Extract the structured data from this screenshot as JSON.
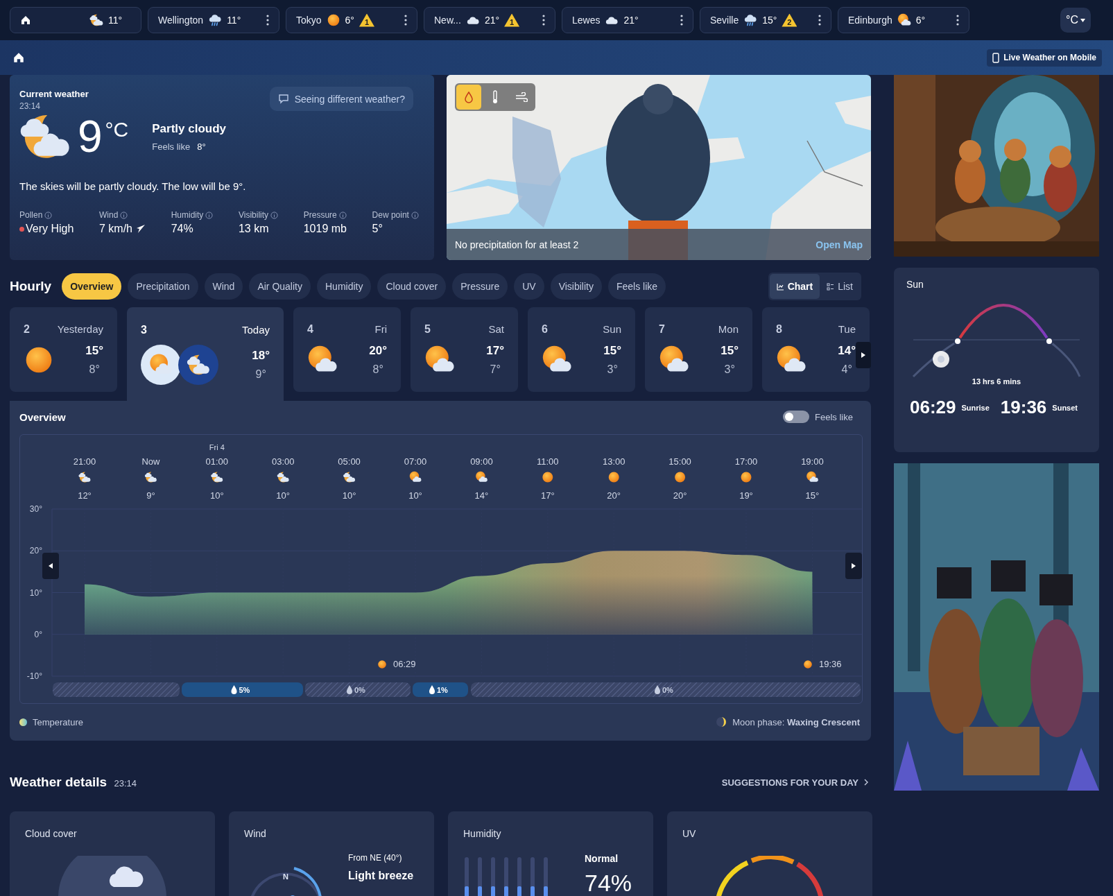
{
  "locations": [
    {
      "kind": "moon-cloud",
      "temp": "11°"
    },
    {
      "kind": "rain-cloud",
      "name": "Wellington",
      "temp": "11°"
    },
    {
      "kind": "sun",
      "name": "Tokyo",
      "temp": "6°",
      "alert": "1"
    },
    {
      "kind": "cloud",
      "name": "New...",
      "temp": "21°",
      "alert": "1"
    },
    {
      "kind": "cloud",
      "name": "Lewes",
      "temp": "21°"
    },
    {
      "kind": "rain-cloud",
      "name": "Seville",
      "temp": "15°",
      "alert": "2"
    },
    {
      "kind": "sun-cloud",
      "name": "Edinburgh",
      "temp": "6°"
    }
  ],
  "unit_button": "°C",
  "mobile_link": "Live Weather on Mobile",
  "current": {
    "title": "Current weather",
    "time": "23:14",
    "temp": "9",
    "unit": "°C",
    "condition": "Partly cloudy",
    "feels_like_label": "Feels like",
    "feels_like": "8°",
    "feedback_button": "Seeing different weather?",
    "summary": "The skies will be partly cloudy. The low will be 9°.",
    "stats": [
      {
        "kind": "pollen",
        "label": "Pollen",
        "value": "Very High"
      },
      {
        "kind": "wind",
        "label": "Wind",
        "value": "7 km/h"
      },
      {
        "kind": "plain",
        "label": "Humidity",
        "value": "74%"
      },
      {
        "kind": "plain",
        "label": "Visibility",
        "value": "13 km"
      },
      {
        "kind": "plain",
        "label": "Pressure",
        "value": "1019 mb"
      },
      {
        "kind": "plain",
        "label": "Dew point",
        "value": "5°"
      }
    ]
  },
  "map": {
    "layers": [
      {
        "kind": "precipitation",
        "selected": true
      },
      {
        "kind": "temperature",
        "selected": false
      },
      {
        "kind": "wind",
        "selected": false
      }
    ],
    "message": "No precipitation for at least 2",
    "link": "Open Map"
  },
  "hourly": {
    "title": "Hourly",
    "tabs": [
      {
        "label": "Overview",
        "selected": true
      },
      {
        "label": "Precipitation",
        "selected": false
      },
      {
        "label": "Wind",
        "selected": false
      },
      {
        "label": "Air Quality",
        "selected": false
      },
      {
        "label": "Humidity",
        "selected": false
      },
      {
        "label": "Cloud cover",
        "selected": false
      },
      {
        "label": "Pressure",
        "selected": false
      },
      {
        "label": "UV",
        "selected": false
      },
      {
        "label": "Visibility",
        "selected": false
      },
      {
        "label": "Feels like",
        "selected": false
      }
    ],
    "views": [
      {
        "kind": "chart",
        "label": "Chart",
        "selected": true
      },
      {
        "kind": "list",
        "label": "List",
        "selected": false
      }
    ],
    "days": [
      {
        "kind": "sun",
        "number": "2",
        "name": "Yesterday",
        "high": "15°",
        "low": "8°",
        "selected": false
      },
      {
        "kind": "day-night",
        "number": "3",
        "name": "Today",
        "high": "18°",
        "low": "9°",
        "selected": true
      },
      {
        "kind": "sun-cloud",
        "number": "4",
        "name": "Fri",
        "high": "20°",
        "low": "8°",
        "selected": false
      },
      {
        "kind": "sun-cloud",
        "number": "5",
        "name": "Sat",
        "high": "17°",
        "low": "7°",
        "selected": false
      },
      {
        "kind": "sun-cloud",
        "number": "6",
        "name": "Sun",
        "high": "15°",
        "low": "3°",
        "selected": false
      },
      {
        "kind": "sun-cloud",
        "number": "7",
        "name": "Mon",
        "high": "15°",
        "low": "3°",
        "selected": false
      },
      {
        "kind": "sun-cloud",
        "number": "8",
        "name": "Tue",
        "high": "14°",
        "low": "4°",
        "selected": false
      }
    ]
  },
  "overview": {
    "title": "Overview",
    "toggle": {
      "label": "Feels like",
      "on": false
    },
    "hours": [
      {
        "kind": "moon-cloud",
        "temp": "12°"
      },
      {
        "kind": "moon-cloud",
        "temp": "9°"
      },
      {
        "kind": "moon-cloud",
        "date": "Fri 4",
        "temp": "10°"
      },
      {
        "kind": "moon-cloud",
        "temp": "10°"
      },
      {
        "kind": "moon-cloud",
        "temp": "10°"
      },
      {
        "kind": "sun-cloud",
        "temp": "10°"
      },
      {
        "kind": "sun-cloud",
        "temp": "14°"
      },
      {
        "kind": "sun",
        "temp": "17°"
      },
      {
        "kind": "sun",
        "temp": "20°"
      },
      {
        "kind": "sun",
        "temp": "20°"
      },
      {
        "kind": "sun",
        "temp": "19°"
      },
      {
        "kind": "sun-cloud",
        "temp": "15°"
      }
    ],
    "chart_data": {
      "type": "area",
      "categories": [
        "21:00",
        "Now",
        "01:00",
        "03:00",
        "05:00",
        "07:00",
        "09:00",
        "11:00",
        "13:00",
        "15:00",
        "17:00",
        "19:00"
      ],
      "series": [
        {
          "name": "Temperature",
          "values": [
            12,
            9,
            10,
            10,
            10,
            10,
            14,
            17,
            20,
            20,
            19,
            15
          ]
        }
      ],
      "ylim": [
        -10,
        30
      ],
      "grid": true,
      "yticks": [
        {
          "value": 30,
          "label": "30°"
        },
        {
          "value": 20,
          "label": "20°"
        },
        {
          "value": 10,
          "label": "10°"
        },
        {
          "value": 0,
          "label": "0°"
        },
        {
          "value": -10,
          "label": "-10°"
        }
      ]
    },
    "sunrise": "06:29",
    "sunset": "19:36",
    "precipitation": [
      {
        "kind": "dry"
      },
      {
        "kind": "rain",
        "label": "5%"
      },
      {
        "kind": "dry",
        "label": "0%"
      },
      {
        "kind": "rain",
        "label": "1%"
      },
      {
        "kind": "dry",
        "label": "0%"
      }
    ],
    "moon_phase": "Moon phase: **Waxing Crescent**"
  },
  "sun": {
    "title": "Sun",
    "duration": "13 hrs 6 mins",
    "sunrise": "06:29",
    "sunrise_label": "Sunrise",
    "sunset": "19:36",
    "sunset_label": "Sunset"
  },
  "details": {
    "title": "Weather details",
    "time": "23:14",
    "link": "SUGGESTIONS FOR YOUR DAY",
    "cards": [
      {
        "kind": "cloud",
        "title": "Cloud cover"
      },
      {
        "kind": "wind",
        "title": "Wind",
        "compass": "N",
        "direction": "From NE (40°)",
        "description": "Light breeze"
      },
      {
        "kind": "humidity",
        "title": "Humidity",
        "description": "Normal",
        "value": "74%"
      },
      {
        "kind": "uv",
        "title": "UV"
      }
    ]
  }
}
